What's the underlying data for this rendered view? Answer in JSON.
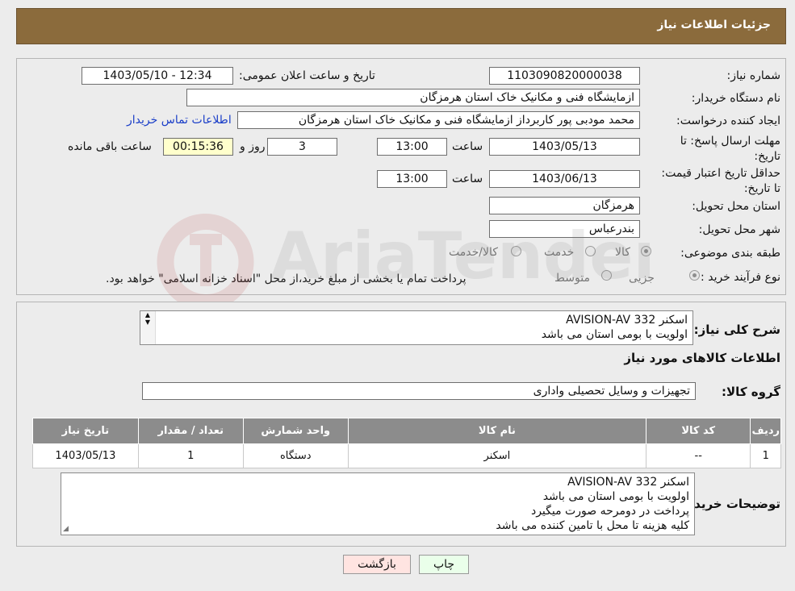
{
  "header": {
    "title": "جزئیات اطلاعات نیاز"
  },
  "fields": {
    "need_number_label": "شماره نیاز:",
    "need_number": "1103090820000038",
    "announce_label": "تاریخ و ساعت اعلان عمومی:",
    "announce_value": "1403/05/10 - 12:34",
    "buyer_org_label": "نام دستگاه خریدار:",
    "buyer_org": "ازمایشگاه فنی و مکانیک خاک استان هرمزگان",
    "creator_label": "ایجاد کننده درخواست:",
    "creator": "محمد  مودبی پور کاربرداز ازمایشگاه فنی و مکانیک خاک استان هرمزگان",
    "contact_link": "اطلاعات تماس خریدار",
    "deadline_label": "مهلت ارسال پاسخ: تا تاریخ:",
    "deadline_date": "1403/05/13",
    "time_label": "ساعت",
    "deadline_time": "13:00",
    "days_value": "3",
    "days_label": "روز و",
    "remaining_time": "00:15:36",
    "remaining_label": "ساعت باقی مانده",
    "validity_label": "حداقل تاریخ اعتبار قیمت: تا تاریخ:",
    "validity_date": "1403/06/13",
    "validity_time": "13:00",
    "province_label": "استان محل تحویل:",
    "province": "هرمزگان",
    "city_label": "شهر محل تحویل:",
    "city": "بندرعباس",
    "category_label": "طبقه بندی موضوعی:",
    "category_options": [
      "کالا",
      "خدمت",
      "کالا/خدمت"
    ],
    "process_label": "نوع فرآیند خرید :",
    "process_options": [
      "جزیی",
      "متوسط"
    ],
    "process_note": "پرداخت تمام یا بخشی از مبلغ خرید،از محل \"اسناد خزانه اسلامی\" خواهد بود."
  },
  "description": {
    "label": "شرح کلی نیاز:",
    "lines": [
      "اسکنر AVISION-AV 332",
      "اولویت با بومی استان می باشد"
    ]
  },
  "goods": {
    "section_title": "اطلاعات کالاهای مورد نیاز",
    "group_label": "گروه کالا:",
    "group_value": "تجهیزات و وسایل تحصیلی واداری",
    "columns": [
      "ردیف",
      "کد کالا",
      "نام کالا",
      "واحد شمارش",
      "تعداد / مقدار",
      "تاریخ نیاز"
    ],
    "rows": [
      [
        "1",
        "--",
        "اسکنر",
        "دستگاه",
        "1",
        "1403/05/13"
      ]
    ]
  },
  "buyer_notes": {
    "label": "توضیحات خریدار:",
    "lines": [
      "اسکنر AVISION-AV 332",
      "اولویت با بومی استان می باشد",
      "پرداخت در دومرحه صورت میگیرد",
      "کلیه هزینه تا محل با تامین کننده می باشد"
    ]
  },
  "buttons": {
    "print": "چاپ",
    "back": "بازگشت"
  },
  "watermark": {
    "text": "AriaTender.neT"
  },
  "colors": {
    "header_bg": "#8b6b3c",
    "table_header": "#8c8c8c",
    "link": "#1a3ec8",
    "timer_bg": "#ffffcc",
    "back_bg": "#ffe4e1",
    "print_bg": "#eaffea"
  }
}
